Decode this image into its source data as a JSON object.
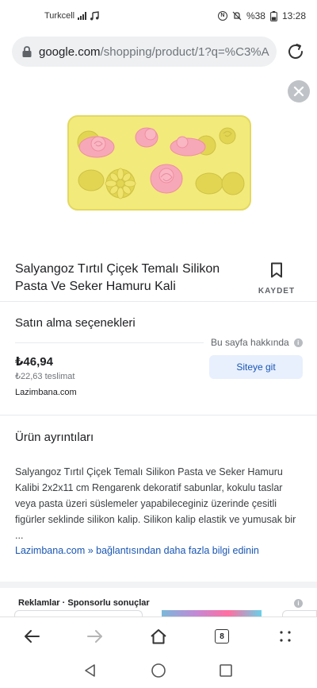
{
  "status_bar": {
    "carrier": "Turkcell",
    "battery": "%38",
    "time": "13:28"
  },
  "address_bar": {
    "host": "google.com",
    "path": "/shopping/product/1?q=%C3%A"
  },
  "product": {
    "title": "Salyangoz Tırtıl Çiçek Temalı Silikon Pasta Ve Seker Hamuru Kali",
    "save_label": "KAYDET"
  },
  "offers": {
    "section_title": "Satın alma seçenekleri",
    "about_page": "Bu sayfa hakkında",
    "price": "₺46,94",
    "shipping": "₺22,63 teslimat",
    "merchant": "Lazimbana.com",
    "visit_button": "Siteye git"
  },
  "details": {
    "section_title": "Ürün ayrıntıları",
    "description": "Salyangoz Tırtıl Çiçek Temalı Silikon Pasta ve Seker Hamuru Kalibi 2x2x11 cm Rengarenk dekoratif sabunlar, kokulu taslar veya pasta üzeri süslemeler yapabileceginiz üzerinde çesitli figürler seklinde silikon kalip. Silikon kalip elastik ve yumusak bir ...",
    "more_link": "Lazimbana.com » bağlantısından daha fazla bilgi edinin"
  },
  "ads": {
    "label": "Reklamlar · Sponsorlu sonuçlar"
  },
  "toolbar": {
    "tab_count": "8"
  },
  "colors": {
    "accent": "#1a56b4",
    "button_bg": "#e8f0fe",
    "mold_yellow": "#f2ea7a",
    "flower_pink": "#f7a8b8"
  },
  "icons": [
    "lock-icon",
    "reload-icon",
    "close-icon",
    "bookmark-icon",
    "info-icon",
    "back-icon",
    "forward-icon",
    "home-icon",
    "tabs-icon",
    "menu-icon"
  ]
}
